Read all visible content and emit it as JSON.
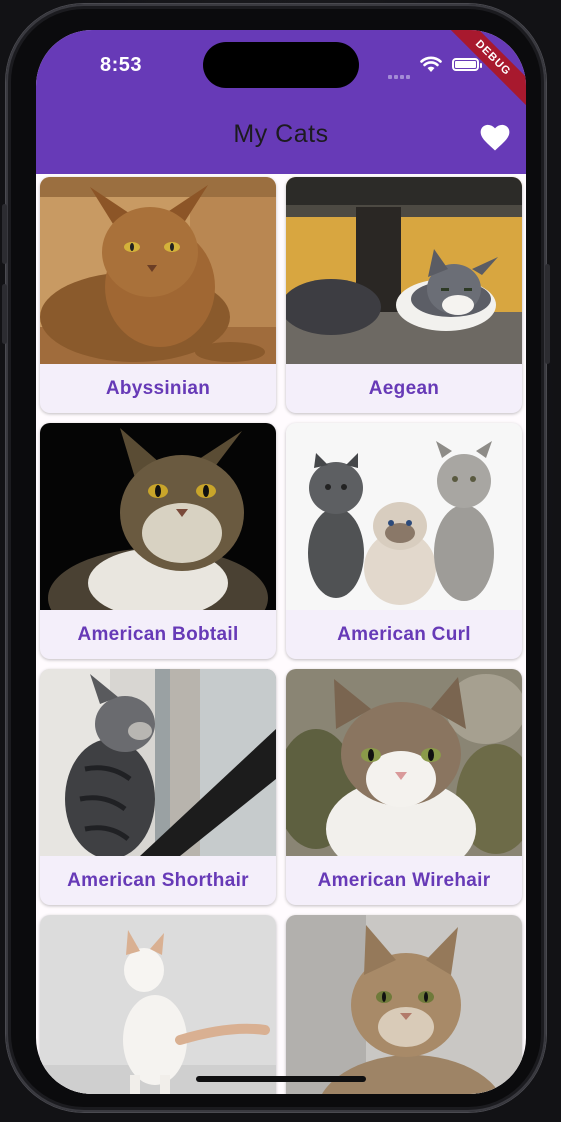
{
  "status_bar": {
    "time": "8:53",
    "debug_banner": "DEBUG"
  },
  "app_bar": {
    "title": "My Cats",
    "favorites_icon": "heart-icon"
  },
  "colors": {
    "primary": "#673ab7",
    "card_bg": "#f4effa",
    "screen_bg": "#fffbfe",
    "debug": "#a8192e"
  },
  "cats": [
    {
      "name": "Abyssinian"
    },
    {
      "name": "Aegean"
    },
    {
      "name": "American Bobtail"
    },
    {
      "name": "American Curl"
    },
    {
      "name": "American Shorthair"
    },
    {
      "name": "American Wirehair"
    },
    {
      "name": ""
    },
    {
      "name": ""
    }
  ]
}
